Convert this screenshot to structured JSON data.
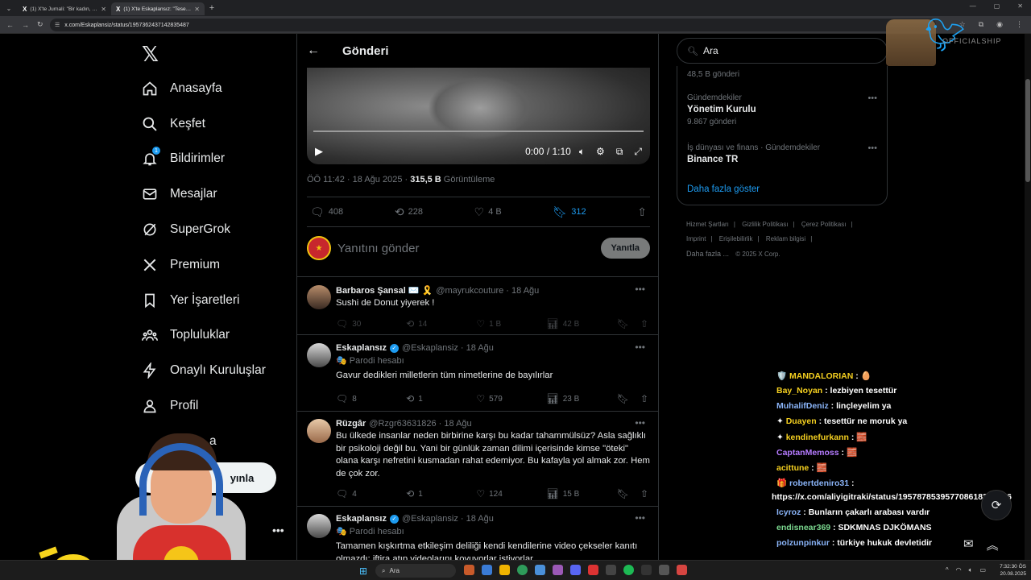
{
  "browser": {
    "tabs": [
      {
        "title": "(1) X'te Jurnali: \"Bir kadın, kendi"
      },
      {
        "title": "(1) X'te Eskaplansız: \"Tesettürlü"
      }
    ],
    "url": "x.com/Eskaplansiz/status/1957362437142835487"
  },
  "nav": {
    "items": [
      {
        "label": "Anasayfa",
        "icon": "home-icon"
      },
      {
        "label": "Keşfet",
        "icon": "search-icon"
      },
      {
        "label": "Bildirimler",
        "icon": "bell-icon",
        "badge": "1"
      },
      {
        "label": "Mesajlar",
        "icon": "mail-icon"
      },
      {
        "label": "SuperGrok",
        "icon": "grok-icon"
      },
      {
        "label": "Premium",
        "icon": "x-premium-icon"
      },
      {
        "label": "Yer İşaretleri",
        "icon": "bookmark-icon"
      },
      {
        "label": "Topluluklar",
        "icon": "communities-icon"
      },
      {
        "label": "Onaylı Kuruluşlar",
        "icon": "lightning-icon"
      },
      {
        "label": "Profil",
        "icon": "profile-icon"
      }
    ],
    "partial_more": "a",
    "post_button": "yınla",
    "account_name": "nli",
    "account_sub": "i"
  },
  "post": {
    "header": "Gönderi",
    "video_time": "0:00 / 1:10",
    "timestamp": "ÖÖ 11:42 · 18 Ağu 2025 · ",
    "views": "315,5 B",
    "views_label": " Görüntüleme",
    "replies": "408",
    "reposts": "228",
    "likes": "4 B",
    "bookmarks": "312",
    "reply_placeholder": "Yanıtını gönder",
    "reply_button": "Yanıtla"
  },
  "tweets": [
    {
      "name": "Barbaros Şansal ✉️ 🎗️",
      "handle": "@mayrukcouture · 18 Ağu",
      "text": "Sushi de Donut yiyerek !",
      "replies": "30",
      "reposts": "14",
      "likes": "1 B",
      "views": "42 B"
    },
    {
      "name": "Eskaplansız",
      "handle": "@Eskaplansiz · 18 Ağu",
      "parody": "Parodi hesabı",
      "text": "Gavur dedikleri milletlerin tüm nimetlerine de bayılırlar",
      "replies": "8",
      "reposts": "1",
      "likes": "579",
      "views": "23 B"
    },
    {
      "name": "Rüzgâr",
      "handle": "@Rzgr63631826 · 18 Ağu",
      "text": "Bu ülkede insanlar neden birbirine karşı bu kadar tahammülsüz? Asla sağlıklı bir psikoloji değil bu. Yani bir günlük zaman dilimi içerisinde kimse \"öteki\" olana karşı nefretini kusmadan rahat edemiyor. Bu kafayla yol almak zor. Hem de çok zor.",
      "replies": "4",
      "reposts": "1",
      "likes": "124",
      "views": "15 B"
    },
    {
      "name": "Eskaplansız",
      "handle": "@Eskaplansiz · 18 Ağu",
      "parody": "Parodi hesabı",
      "text": "Tamamen kışkırtma etkileşim deliliği kendi kendilerine video çekseler kanıtı olmazdı; iftira atıp videolarını koyuyorlar istiyorlar"
    }
  ],
  "sidebar": {
    "search_placeholder": "Ara",
    "top_count": "48,5 B gönderi",
    "trends": [
      {
        "category": "Gündemdekiler",
        "name": "Yönetim Kurulu",
        "count": "9.867 gönderi"
      },
      {
        "category": "İş dünyası ve finans · Gündemdekiler",
        "name": "Binance TR",
        "count": ""
      }
    ],
    "show_more": "Daha fazla göster",
    "footer": [
      "Hizmet Şartları",
      "|",
      "Gizlilik Politikası",
      "|",
      "Çerez Politikası",
      "|",
      "Imprint",
      "|",
      "Erişilebilirlik",
      "|",
      "Reklam bilgisi",
      "|",
      "Daha fazla ...",
      "© 2025 X Corp."
    ]
  },
  "overlay": {
    "watermark": "OFFICIALSHIP"
  },
  "chat": [
    {
      "user": "MANDALORIAN",
      "msg": " : 🥚",
      "color": "#f5d020"
    },
    {
      "user": "Bay_Noyan",
      "msg": " : lezbiyen tesettür",
      "color": "#f5d020"
    },
    {
      "user": "MuhalifDeniz",
      "msg": " : linçleyelim ya",
      "color": "#8ab4f8"
    },
    {
      "user": "Duayen",
      "msg": " : tesettür ne moruk ya",
      "color": "#f5d020"
    },
    {
      "user": "kendinefurkann",
      "msg": " : 🧱",
      "color": "#f5d020"
    },
    {
      "user": "CaptanMemoss",
      "msg": " : 🧱",
      "color": "#b57bff"
    },
    {
      "user": "acittune",
      "msg": " : 🧱",
      "color": "#f5d020"
    },
    {
      "user": "robertdeniro31",
      "msg": " :",
      "color": "#8ab4f8"
    },
    {
      "user": "",
      "msg": "https://x.com/aliyigitraki/status/1957878539577086183?s=46",
      "color": "#ffffff"
    },
    {
      "user": "Icyroz",
      "msg": " : Bunların çakarlı arabası vardır",
      "color": "#8ab4f8"
    },
    {
      "user": "endisnear369",
      "msg": " : SDKMNAS DJKÖMANS",
      "color": "#7bd88f"
    },
    {
      "user": "polzunpinkur",
      "msg": " : türkiye hukuk devletidir",
      "color": "#8ab4f8"
    }
  ],
  "taskbar": {
    "search": "Ara",
    "time": "7:32:30 ÖS",
    "date": "20.08.2025"
  },
  "colors": {
    "accent": "#1d9bf0",
    "background": "#000000",
    "muted": "#71767b"
  }
}
